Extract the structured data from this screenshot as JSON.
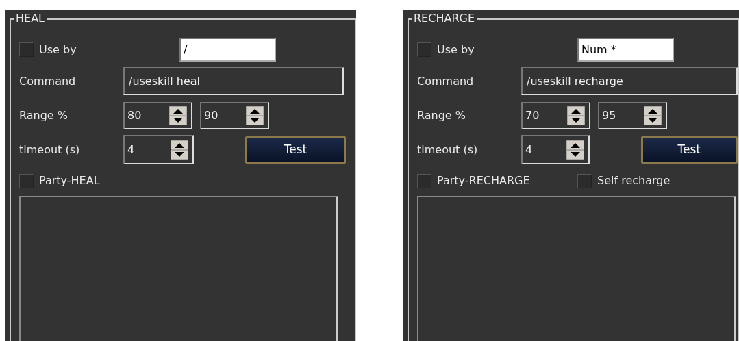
{
  "panels": [
    {
      "legend": "HEAL",
      "use_by": {
        "label": "Use by",
        "checked": false,
        "hotkey": "/"
      },
      "command": {
        "label": "Command",
        "value": "/useskill heal"
      },
      "range": {
        "label": "Range %",
        "min": "80",
        "max": "90"
      },
      "timeout": {
        "label": "timeout (s)",
        "value": "4"
      },
      "test_button": "Test",
      "options": [
        {
          "label": "Party-HEAL",
          "checked": false
        }
      ]
    },
    {
      "legend": "RECHARGE",
      "use_by": {
        "label": "Use by",
        "checked": false,
        "hotkey": "Num *"
      },
      "command": {
        "label": "Command",
        "value": "/useskill recharge"
      },
      "range": {
        "label": "Range %",
        "min": "70",
        "max": "95"
      },
      "timeout": {
        "label": "timeout (s)",
        "value": "4"
      },
      "test_button": "Test",
      "options": [
        {
          "label": "Party-RECHARGE",
          "checked": false
        },
        {
          "label": "Self recharge",
          "checked": false
        }
      ]
    }
  ]
}
